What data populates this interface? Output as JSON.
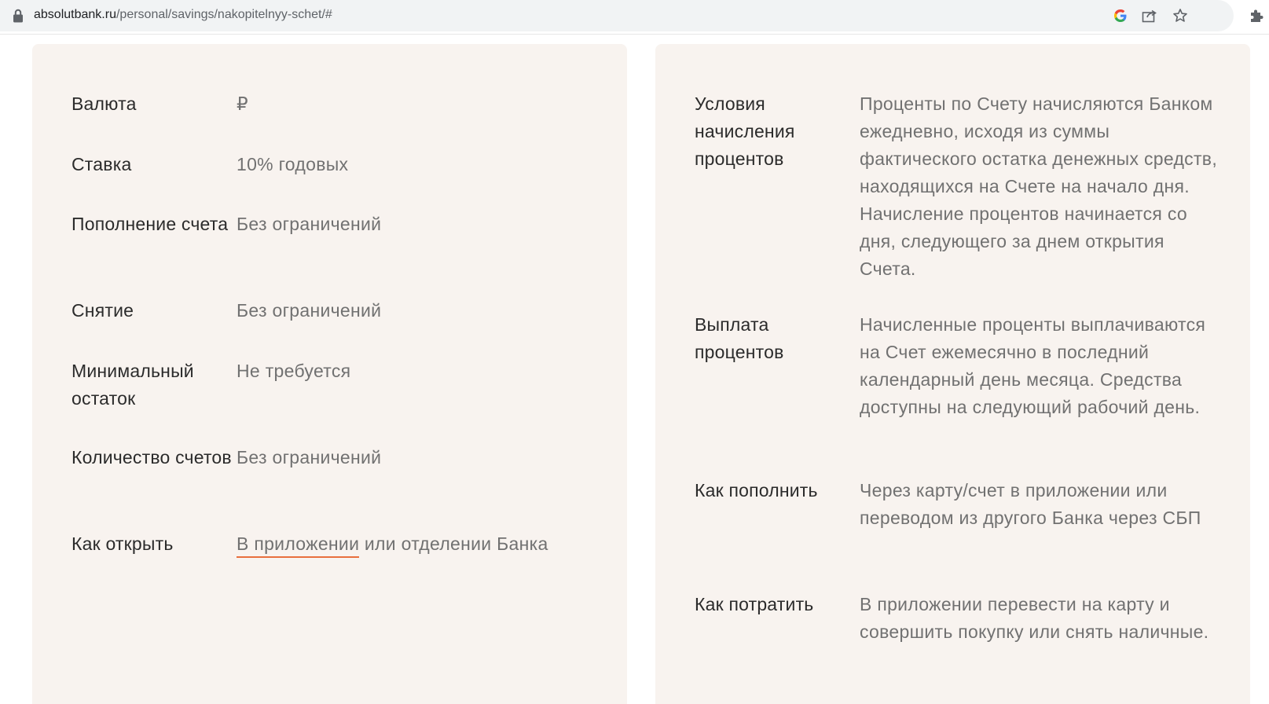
{
  "browser": {
    "url_host": "absolutbank.ru",
    "url_path": "/personal/savings/nakopitelnyy-schet/#"
  },
  "left": {
    "rows": [
      {
        "label": "Валюта",
        "value": "₽"
      },
      {
        "label": "Ставка",
        "value": "10% годовых"
      },
      {
        "label": "Пополнение счета",
        "value": "Без ограничений"
      },
      {
        "label": "Снятие",
        "value": "Без ограничений"
      },
      {
        "label": "Минимальный остаток",
        "value": "Не требуется"
      },
      {
        "label": "Количество счетов",
        "value": "Без ограничений"
      }
    ],
    "how_to_open": {
      "label": "Как открыть",
      "link": "В приложении",
      "rest": " или отделении Банка"
    }
  },
  "right": {
    "rows": [
      {
        "label": "Условия начисления процентов",
        "value": "Проценты по Счету начисляются Банком ежедневно, исходя из суммы фактического остатка денежных средств, находящихся на Счете на начало дня. Начисление процентов начинается со дня, следующего за днем открытия Счета."
      },
      {
        "label": "Выплата процентов",
        "value": "Начисленные проценты выплачиваются на Счет ежемесячно в последний календарный день месяца. Средства доступны на следующий рабочий день."
      },
      {
        "label": "Как пополнить",
        "value": "Через карту/счет в приложении или переводом из другого Банка через СБП"
      },
      {
        "label": "Как потратить",
        "value": "В приложении перевести на карту и совершить покупку или снять наличные."
      }
    ]
  },
  "icons": {
    "lock": "lock-icon",
    "google": "google-icon",
    "share": "share-icon",
    "bookmark": "star-icon",
    "extensions": "puzzle-icon"
  },
  "colors": {
    "panel_bg": "#f8f3ef",
    "link_underline": "#e86f3d"
  }
}
